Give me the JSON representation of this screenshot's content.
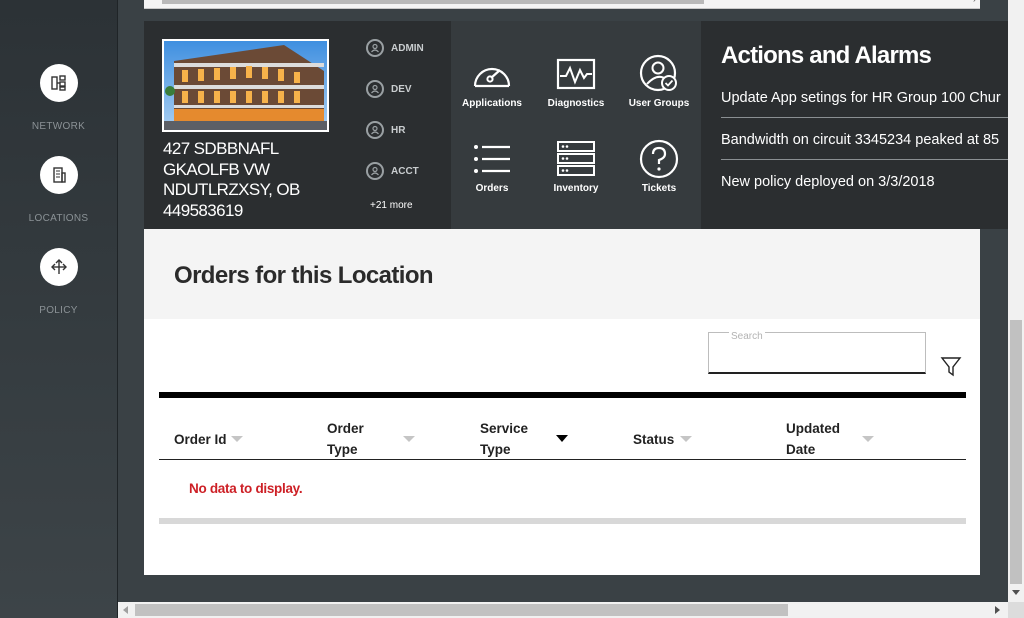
{
  "sidebar": {
    "items": [
      {
        "label": "NETWORK",
        "icon": "network-icon"
      },
      {
        "label": "LOCATIONS",
        "icon": "building-icon"
      },
      {
        "label": "POLICY",
        "icon": "move-arrows-icon"
      }
    ]
  },
  "location": {
    "address_lines": [
      "427 SDBBNAFL",
      "GKAOLFB VW",
      "NDUTLRZXSY, OB",
      "449583619"
    ]
  },
  "roles": {
    "items": [
      {
        "label": "ADMIN",
        "icon": "user-icon"
      },
      {
        "label": "DEV",
        "icon": "user-icon"
      },
      {
        "label": "HR",
        "icon": "user-icon"
      },
      {
        "label": "ACCT",
        "icon": "user-icon"
      }
    ],
    "more_label": "+21 more"
  },
  "tiles": {
    "items": [
      {
        "label": "Applications",
        "icon": "speedometer-icon"
      },
      {
        "label": "Diagnostics",
        "icon": "waveform-icon"
      },
      {
        "label": "User Groups",
        "icon": "user-check-icon"
      },
      {
        "label": "Orders",
        "icon": "list-icon"
      },
      {
        "label": "Inventory",
        "icon": "server-stack-icon"
      },
      {
        "label": "Tickets",
        "icon": "question-circle-icon"
      }
    ]
  },
  "alarms": {
    "title": "Actions and Alarms",
    "items": [
      "Update App setings for HR Group 100 Chur",
      "Bandwidth on circuit 3345234 peaked at 85",
      "New policy deployed on 3/3/2018"
    ]
  },
  "orders": {
    "title": "Orders for this Location",
    "search_label": "Search",
    "search_value": "",
    "columns": [
      {
        "label": "Order Id",
        "sort": "none"
      },
      {
        "label": "Order Type",
        "sort": "none"
      },
      {
        "label": "Service Type",
        "sort": "active"
      },
      {
        "label": "Status",
        "sort": "none"
      },
      {
        "label": "Updated Date",
        "sort": "none"
      }
    ],
    "empty_message": "No data to display."
  },
  "colors": {
    "accent_red": "#cd2026",
    "dark_band": "#2b2e30",
    "tile_bg": "#363b3e"
  }
}
